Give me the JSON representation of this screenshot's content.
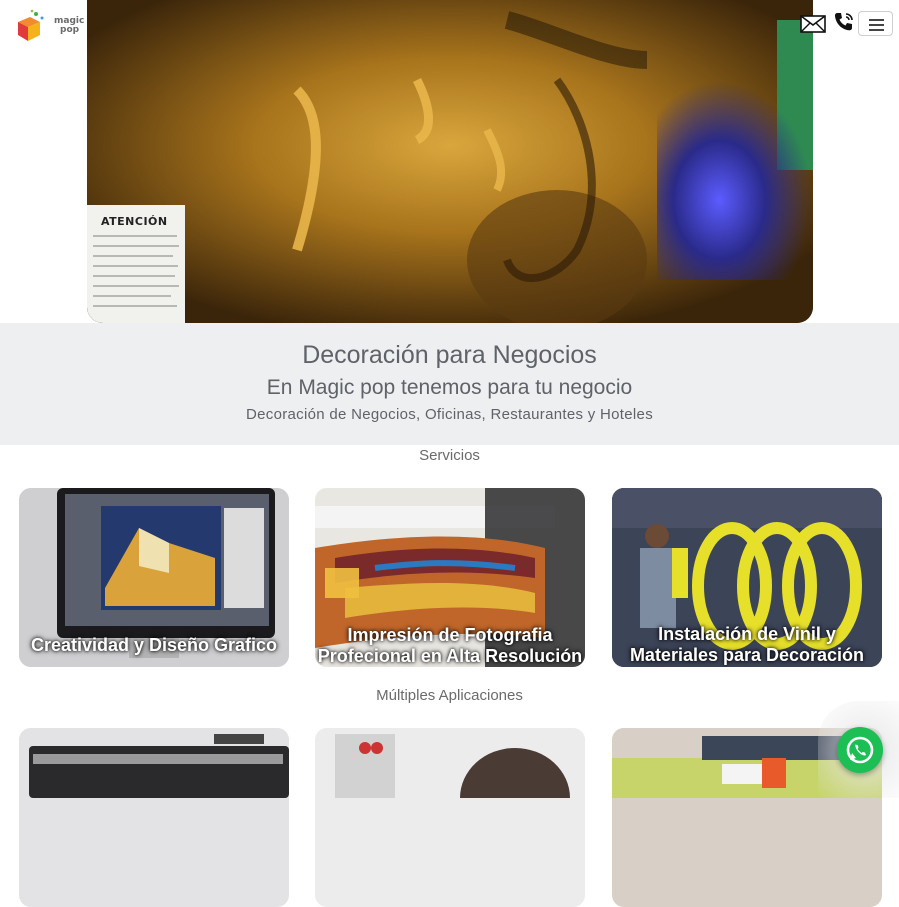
{
  "brand": {
    "logo_line1": "magic",
    "logo_line2": "pop"
  },
  "header": {
    "mail_icon": "envelope-icon",
    "phone_icon": "phone-icon",
    "menu_icon": "hamburger-menu-icon"
  },
  "hero": {
    "notice_title": "ATENCIÓN"
  },
  "intro": {
    "title": "Decoración para Negocios",
    "subtitle": "En Magic pop tenemos para tu negocio",
    "tagline": "Decoración de Negocios, Oficinas, Restaurantes y Hoteles"
  },
  "services": {
    "heading": "Servicios",
    "cards": [
      {
        "label": "Creatividad y Diseño Grafico"
      },
      {
        "label": "Impresión de Fotografia Profecional en Alta Resolución"
      },
      {
        "label": "Instalación de Vinil y Materiales para Decoración"
      }
    ]
  },
  "applications": {
    "heading": "Múltiples Aplicaciones"
  },
  "whatsapp": {
    "icon": "whatsapp-icon"
  },
  "colors": {
    "band_bg": "#eeeff1",
    "text_gray": "#5f6368",
    "whatsapp_green": "#1dbf54"
  }
}
